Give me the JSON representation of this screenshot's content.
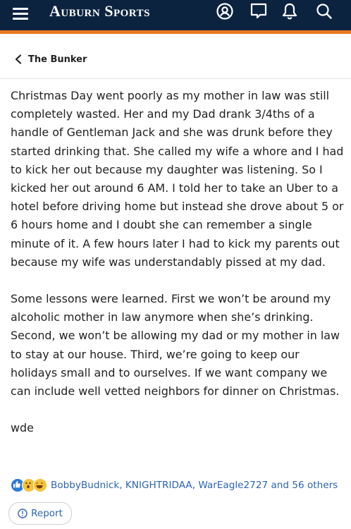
{
  "header": {
    "brand": "Auburn Sports",
    "colors": {
      "bar": "#0c2340",
      "accent": "#e87722"
    },
    "icons": [
      "menu-icon",
      "account-icon",
      "messages-icon",
      "notifications-icon",
      "search-icon"
    ]
  },
  "breadcrumb": {
    "label": "The Bunker",
    "icon": "chevron-left-icon"
  },
  "post": {
    "paragraphs": [
      "Christmas Day went poorly as my mother in law was still completely wasted. Her and my Dad drank 3/4ths of a handle of Gentleman Jack and she was drunk before they started drinking that. She called my wife a whore and I had to kick her out because my daughter was listening. So I kicked her out around 6 AM. I told her to take an Uber to a hotel before driving home but instead she drove about 5 or 6 hours home and I doubt she can remember a single minute of it. A few hours later I had to kick my parents out because my wife was understandably pissed at my dad.",
      "Some lessons were learned. First we won’t be around my alcoholic mother in law anymore when she’s drinking. Second, we won’t be allowing my dad or my mother in law to stay at our house. Third, we’re going to keep our holidays small and to ourselves. If we want company we can include well vetted neighbors for dinner on Christmas.",
      "wde"
    ]
  },
  "reactions": {
    "icons": [
      "like-reaction-icon",
      "wow-reaction-icon",
      "haha-reaction-icon"
    ],
    "text": "BobbyBudnick, KNIGHTRIDAA, WarEagle2727 and 56 others"
  },
  "actions": {
    "report_label": "Report",
    "report_icon": "info-circle-icon"
  }
}
